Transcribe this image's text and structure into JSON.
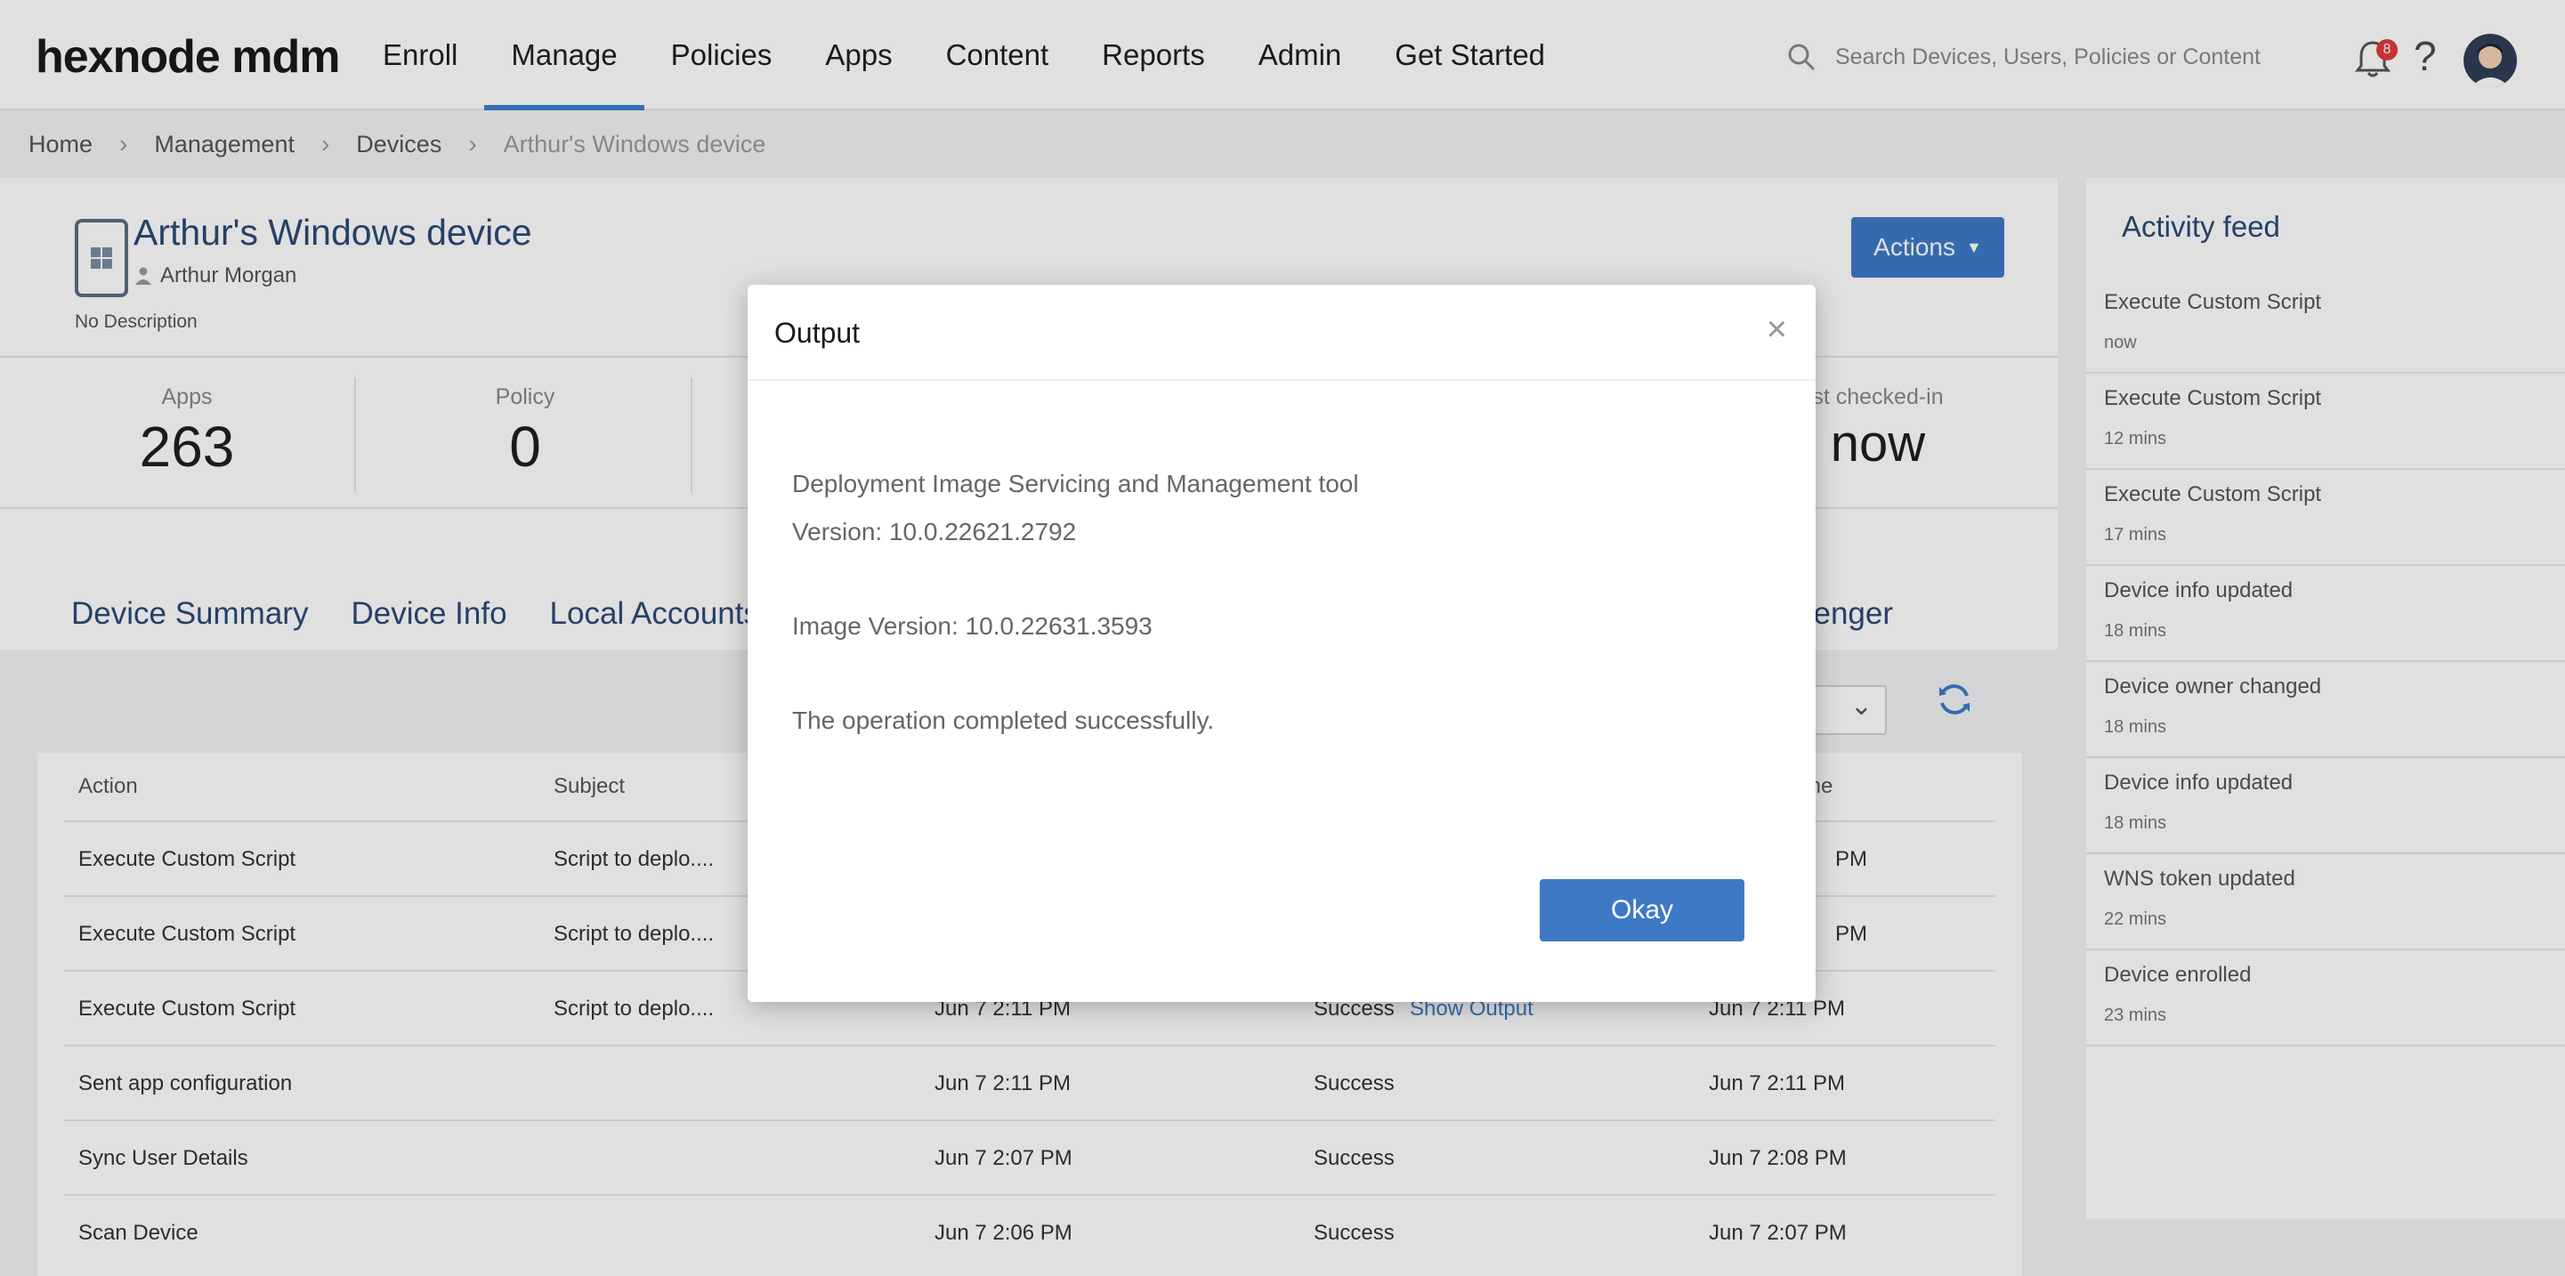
{
  "header": {
    "logo": "hexnode mdm",
    "nav": [
      "Enroll",
      "Manage",
      "Policies",
      "Apps",
      "Content",
      "Reports",
      "Admin",
      "Get Started"
    ],
    "active_nav": "Manage",
    "search_placeholder": "Search Devices, Users, Policies or Content",
    "notification_count": "8",
    "help_label": "?"
  },
  "breadcrumb": [
    "Home",
    "Management",
    "Devices",
    "Arthur's Windows device"
  ],
  "device": {
    "title": "Arthur's Windows device",
    "owner": "Arthur Morgan",
    "description": "No Description",
    "actions_label": "Actions"
  },
  "stats": {
    "apps_label": "Apps",
    "apps_value": "263",
    "policy_label": "Policy",
    "policy_value": "0",
    "checked_label": "st checked-in",
    "checked_value": "now"
  },
  "tabs": [
    "Device Summary",
    "Device Info",
    "Local Accounts"
  ],
  "tab_partial": "senger",
  "table": {
    "headers": [
      "Action",
      "Subject",
      "me"
    ],
    "rows": [
      {
        "action": "Execute Custom Script",
        "subject": "Script to deplo....",
        "time": "PM"
      },
      {
        "action": "Execute Custom Script",
        "subject": "Script to deplo....",
        "time": "PM"
      },
      {
        "action": "Execute Custom Script",
        "subject": "Script to deplo....",
        "created": "Jun 7 2:11 PM",
        "status": "Success",
        "link": "Show Output",
        "time": "Jun 7 2:11 PM"
      },
      {
        "action": "Sent app configuration",
        "subject": "",
        "created": "Jun 7 2:11 PM",
        "status": "Success",
        "link": "",
        "time": "Jun 7 2:11 PM"
      },
      {
        "action": "Sync User Details",
        "subject": "",
        "created": "Jun 7 2:07 PM",
        "status": "Success",
        "link": "",
        "time": "Jun 7 2:08 PM"
      },
      {
        "action": "Scan Device",
        "subject": "",
        "created": "Jun 7 2:06 PM",
        "status": "Success",
        "link": "",
        "time": "Jun 7 2:07 PM"
      }
    ]
  },
  "feed": {
    "title": "Activity feed",
    "items": [
      {
        "title": "Execute Custom Script",
        "time": "now"
      },
      {
        "title": "Execute Custom Script",
        "time": "12 mins"
      },
      {
        "title": "Execute Custom Script",
        "time": "17 mins"
      },
      {
        "title": "Device info updated",
        "time": "18 mins"
      },
      {
        "title": "Device owner changed",
        "time": "18 mins"
      },
      {
        "title": "Device info updated",
        "time": "18 mins"
      },
      {
        "title": "WNS token updated",
        "time": "22 mins"
      },
      {
        "title": "Device enrolled",
        "time": "23 mins"
      }
    ]
  },
  "modal": {
    "title": "Output",
    "close": "×",
    "line1": "Deployment Image Servicing and Management tool",
    "line2": "Version: 10.0.22621.2792",
    "line3": "Image Version: 10.0.22631.3593",
    "line4": "The operation completed successfully.",
    "okay_label": "Okay"
  },
  "colors": {
    "accent": "#3e79c6",
    "title_blue": "#2b4a75",
    "badge_red": "#e0393e"
  }
}
